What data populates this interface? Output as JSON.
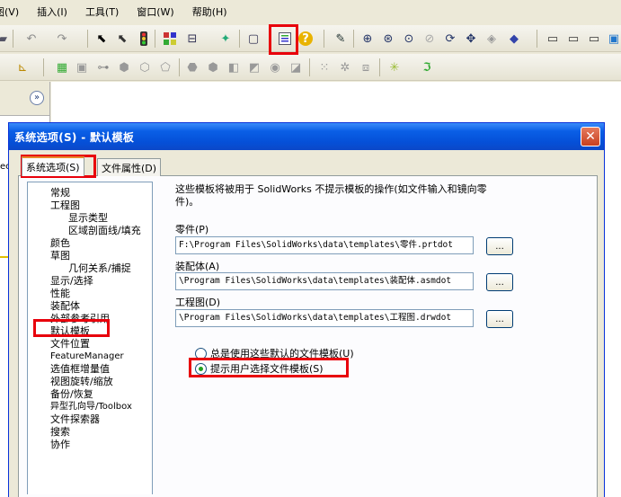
{
  "menu": [
    "图(V)",
    "插入(I)",
    "工具(T)",
    "窗口(W)",
    "帮助(H)"
  ],
  "toolbar1_icons": [
    "print-icon",
    "undo-icon",
    "redo-icon",
    "select-icon",
    "select-filter-icon",
    "traffic-light-icon",
    "grid-icon",
    "smart-dimension-icon",
    "rebuild-icon",
    "options-window-icon",
    "options-list-icon",
    "help-icon",
    "sketch-icon",
    "zoom-to-fit-icon",
    "zoom-area-icon",
    "zoom-in-icon",
    "zoom-out-icon",
    "rotate-icon",
    "pan-icon",
    "shaded-icon",
    "view-orientation-icon",
    "front-view-icon",
    "right-view-icon",
    "top-view-icon",
    "iso-view-icon"
  ],
  "toolbar2_icons": [
    "dimension-icon",
    "plane-icon",
    "boss-extrude-icon",
    "revolve-icon",
    "sweep-icon",
    "loft-icon",
    "shell-icon",
    "fillet-icon",
    "chamfer-icon",
    "rib-icon",
    "draft-icon",
    "hole-icon",
    "linear-pattern-icon",
    "circular-pattern-icon",
    "mirror-icon",
    "reference-geometry-icon",
    "curve-icon"
  ],
  "fm_cut_text": "ec",
  "dialog": {
    "title": "系统选项(S) - 默认模板",
    "close": "✕",
    "tabs": [
      "系统选项(S)",
      "文件属性(D)"
    ],
    "tree": [
      "常规",
      "工程图",
      "显示类型",
      "区域剖面线/填充",
      "颜色",
      "草图",
      "几何关系/捕捉",
      "显示/选择",
      "性能",
      "装配体",
      "外部参考引用",
      "默认模板",
      "文件位置",
      "FeatureManager",
      "选值框增量值",
      "视图旋转/缩放",
      "备份/恢复",
      "异型孔向导/Toolbox",
      "文件探索器",
      "搜索",
      "协作"
    ],
    "description": "这些模板将被用于 SolidWorks 不提示模板的操作(如文件输入和镜向零件)。",
    "part_label": "零件(P)",
    "part_value": "F:\\Program Files\\SolidWorks\\data\\templates\\零件.prtdot",
    "assembly_label": "装配体(A)",
    "assembly_value": "\\Program Files\\SolidWorks\\data\\templates\\装配体.asmdot",
    "drawing_label": "工程图(D)",
    "drawing_value": "\\Program Files\\SolidWorks\\data\\templates\\工程图.drwdot",
    "browse": "...",
    "radio_always": "总是使用这些默认的文件模板(U)",
    "radio_prompt": "提示用户选择文件模板(S)",
    "selected_radio": "prompt"
  }
}
